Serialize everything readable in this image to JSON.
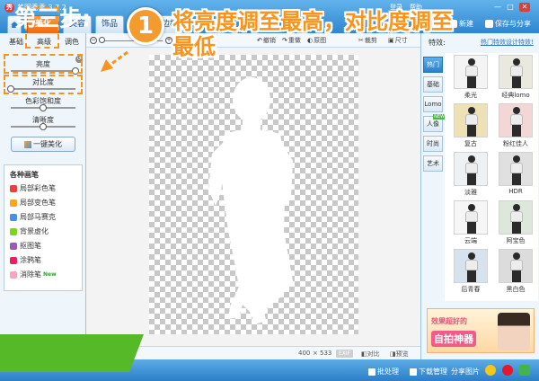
{
  "window": {
    "app_title": "美图秀秀 3.7.2",
    "top_links": [
      "登录",
      "帮助"
    ],
    "window_buttons": [
      "—",
      "□",
      "✕"
    ]
  },
  "nav": {
    "tabs": [
      "美化",
      "美容",
      "饰品",
      "边框"
    ],
    "active_tab": "美化"
  },
  "top_actions": {
    "new_label": "新建",
    "save_share_label": "保存与分享"
  },
  "left_panel": {
    "sub_tabs": [
      "基础",
      "高级",
      "调色"
    ],
    "sliders": [
      {
        "label": "亮度",
        "value": 1.0
      },
      {
        "label": "对比度",
        "value": 0.0
      },
      {
        "label": "色彩饱和度",
        "value": 0.5
      },
      {
        "label": "清晰度",
        "value": 0.5
      }
    ],
    "one_click_button": "一键美化",
    "pens_title": "各种画笔",
    "pens": [
      {
        "label": "局部彩色笔",
        "color": "#e8413c",
        "new": false
      },
      {
        "label": "局部变色笔",
        "color": "#f5a623",
        "new": false
      },
      {
        "label": "局部马赛克",
        "color": "#4a90e2",
        "new": false
      },
      {
        "label": "背景虚化",
        "color": "#7ed321",
        "new": false
      },
      {
        "label": "抠图笔",
        "color": "#9b59b6",
        "new": false
      },
      {
        "label": "涂鸦笔",
        "color": "#e91e63",
        "new": false
      },
      {
        "label": "消除笔",
        "color": "#f8a5c2",
        "new": true
      }
    ],
    "new_badge": "New"
  },
  "canvas_toolbar": {
    "tools": [
      "撤销",
      "重做",
      "原图",
      "裁剪",
      "尺寸"
    ]
  },
  "status_bar": {
    "width": "400",
    "times": "×",
    "height": "533",
    "exif_badge": "EXIF",
    "compare_label": "对比",
    "preview_label": "预览"
  },
  "right_panel": {
    "effects_label": "特效:",
    "design_link": "热门特效设计特效!",
    "categories": [
      {
        "label": "热门",
        "active": true
      },
      {
        "label": "基础",
        "active": false
      },
      {
        "label": "Lomo",
        "active": false
      },
      {
        "label": "人像",
        "active": false,
        "badge": "NEW"
      },
      {
        "label": "时尚",
        "active": false
      },
      {
        "label": "艺术",
        "active": false
      }
    ],
    "effects": [
      {
        "label": "柔光",
        "tint": "#f4f4f4"
      },
      {
        "label": "经典lomo",
        "tint": "#e9e9e0"
      },
      {
        "label": "复古",
        "tint": "#efe1b6"
      },
      {
        "label": "粉红佳人",
        "tint": "#f3d7d7"
      },
      {
        "label": "淡雅",
        "tint": "#eef1f3"
      },
      {
        "label": "HDR",
        "tint": "#e0e0e0"
      },
      {
        "label": "云端",
        "tint": "#f6f6f6"
      },
      {
        "label": "阿宝色",
        "tint": "#dde7dc"
      },
      {
        "label": "后青春",
        "tint": "#d6e3ef"
      },
      {
        "label": "黑白色",
        "tint": "#dcdcdc"
      }
    ],
    "ad": {
      "line1": "效果超好的",
      "line2": "自拍神器"
    }
  },
  "bottom_bar": {
    "batch_label": "批处理",
    "download_label": "下载管理",
    "share_label": "分享图片"
  },
  "overlay": {
    "step_number": "1",
    "instruction": "将亮度调至最高，对比度调至最低",
    "step_banner": "第三步:"
  }
}
